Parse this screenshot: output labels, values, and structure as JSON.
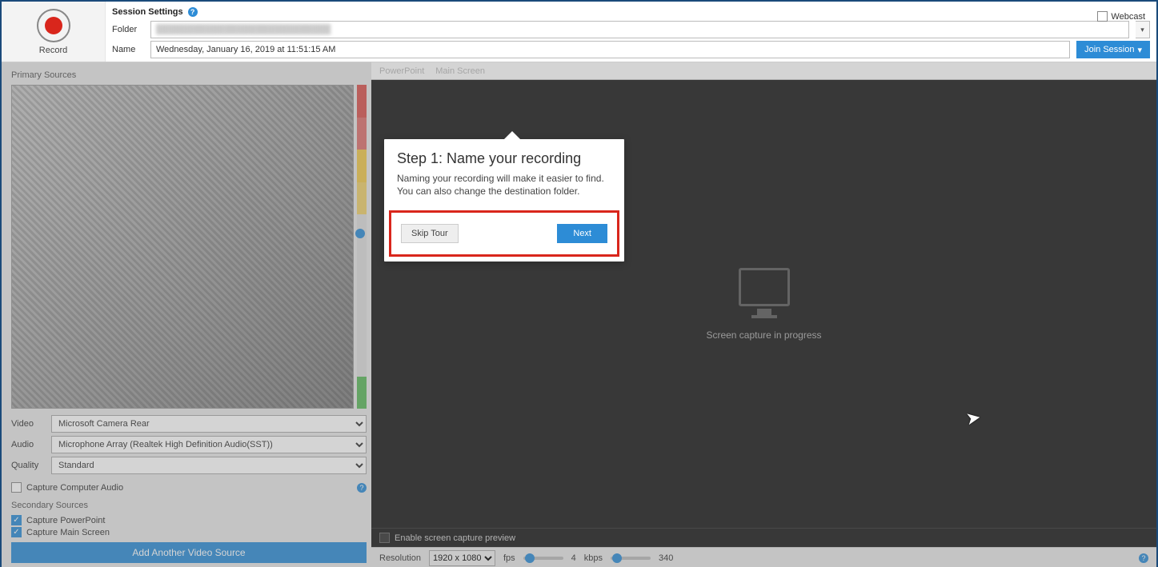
{
  "record": {
    "label": "Record"
  },
  "session": {
    "header": "Session Settings",
    "folder_label": "Folder",
    "folder_value": "████████████████████████████",
    "name_label": "Name",
    "name_value": "Wednesday, January 16, 2019 at 11:51:15 AM",
    "join_label": "Join Session",
    "webcast_label": "Webcast"
  },
  "primary": {
    "title": "Primary Sources",
    "video_label": "Video",
    "video_value": "Microsoft Camera Rear",
    "audio_label": "Audio",
    "audio_value": "Microphone Array (Realtek High Definition Audio(SST))",
    "quality_label": "Quality",
    "quality_value": "Standard",
    "capture_audio_label": "Capture Computer Audio"
  },
  "secondary": {
    "title": "Secondary Sources",
    "ppt_label": "Capture PowerPoint",
    "main_label": "Capture Main Screen",
    "add_label": "Add Another Video Source"
  },
  "tabs": {
    "ppt": "PowerPoint",
    "main": "Main Screen"
  },
  "screen": {
    "status": "Screen capture in progress",
    "enable_preview": "Enable screen capture preview"
  },
  "res": {
    "label": "Resolution",
    "value": "1920 x 1080",
    "fps_label": "fps",
    "fps_value": "4",
    "kbps_label": "kbps",
    "kbps_value": "340"
  },
  "tour": {
    "title": "Step 1: Name your recording",
    "body": "Naming your recording will make it easier to find. You can also change the destination folder.",
    "skip": "Skip Tour",
    "next": "Next"
  }
}
